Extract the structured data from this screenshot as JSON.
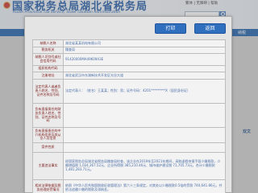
{
  "site": {
    "title_cn": "国家税务总局湖北省税务局",
    "title_en": "Hubei Provincial Tax Service, State Taxation Administration",
    "top_links": "繁体 | 无障碍 | 帮助",
    "search_placeholder": "",
    "nav_side": "纳税",
    "right_tag": "双文"
  },
  "modal": {
    "print_label": "打印",
    "back_label": "返回",
    "rows": [
      {
        "label": "纳税人名称",
        "value": "湖北省某某机电有限公司"
      },
      {
        "label": "税务机关",
        "value": "稽查局"
      },
      {
        "label": "纳税人识别号或社会信用代码",
        "value": "91420000MA49K09A3E"
      },
      {
        "label": "组织机构代码",
        "value": ""
      },
      {
        "label": "注册地址",
        "value": "湖北省武汉市东湖新技术开发区光谷大道"
      },
      {
        "label": "法定代表人或者负责人姓名、性别、证件名称及号码",
        "value": "法定代表人：（姓名）王某某；性别：男；证件号码：4201*********X（居民身份证）"
      },
      {
        "label": "负有直接责任的财务负责人姓名、性别、证件名称及号码",
        "value": ""
      },
      {
        "label": "负有直接责任的中介机构信息及其从业人员信息",
        "value": ""
      },
      {
        "label": "案件性质",
        "value": ""
      },
      {
        "label": "主要违法事实",
        "value": "经国家税务总局湖北省税务局稽查局检查，该企业在2019年至2021年期间，采取虚假申报手段少缴税款，少缴增值税 1,024,367.52元、企业所得税 385,210.46元、城市维护建设税 71,705.73元，合计少缴税款 1,481,283.71元。"
      },
      {
        "label": "相关法律依据及税务处理处罚情况",
        "value": "依照《中华人民共和国税收征收管理法》第六十三条规定，对其处以少缴税款0.5倍的罚款 740,641.86元，并依法追缴少缴的税款及滞纳金。"
      }
    ]
  }
}
